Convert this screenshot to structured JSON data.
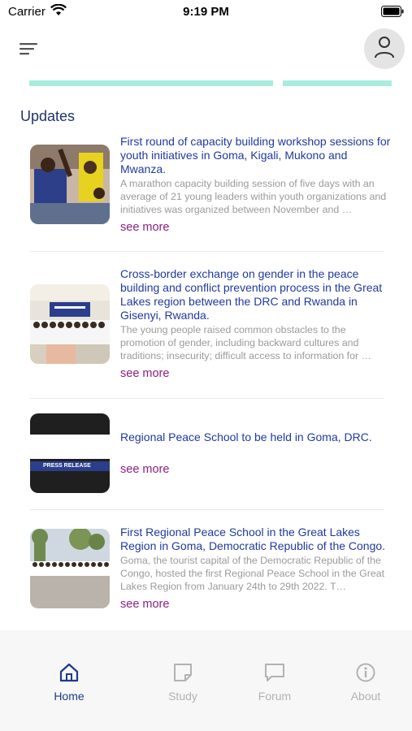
{
  "status_bar": {
    "carrier": "Carrier",
    "time": "9:19 PM"
  },
  "header": {
    "menu_icon": "hamburger-menu-icon",
    "profile_icon": "user-icon"
  },
  "section": {
    "title": "Updates"
  },
  "updates": [
    {
      "title": "First round of capacity building workshop sessions for youth initiatives in Goma, Kigali, Mukono and Mwanza.",
      "excerpt": "A marathon capacity building session of five days with an average of 21 young leaders within youth organizations and initiatives was organized between November and …",
      "link": "see more"
    },
    {
      "title": "Cross-border exchange on gender in the peace building and conflict prevention process in the Great Lakes region between the DRC and Rwanda in Gisenyi, Rwanda.",
      "excerpt": "The young people raised common obstacles to the promotion of gender, including backward cultures and traditions; insecurity; difficult access to information for …",
      "link": "see more"
    },
    {
      "title": "Regional Peace School to be held in Goma, DRC.",
      "excerpt": "",
      "link": "see more",
      "thumb_text": "PRESS RELEASE"
    },
    {
      "title": "First Regional Peace School in the Great Lakes Region in Goma, Democratic Republic of the Congo.",
      "excerpt": "Goma, the tourist capital of the Democratic Republic of the Congo, hosted the first Regional Peace School in the Great Lakes Region from January 24th to 29th 2022. T…",
      "link": "see more"
    }
  ],
  "tabs": [
    {
      "label": "Home",
      "icon": "home-icon",
      "active": true
    },
    {
      "label": "Study",
      "icon": "note-icon",
      "active": false
    },
    {
      "label": "Forum",
      "icon": "chat-bubble-icon",
      "active": false
    },
    {
      "label": "About",
      "icon": "info-icon",
      "active": false
    }
  ],
  "colors": {
    "title": "#1f3aa0",
    "link": "#8b1f83",
    "section": "#1f3568",
    "active_tab": "#1f3a8a",
    "inactive_tab": "#b2b2b2"
  }
}
